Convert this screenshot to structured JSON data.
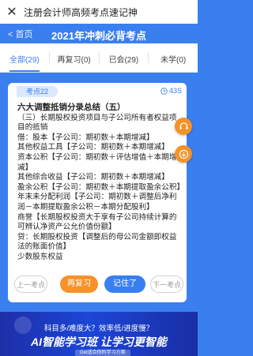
{
  "app": {
    "title": "注册会计师高频考点速记神",
    "close_glyph": "✕"
  },
  "header": {
    "back_label": "< 首页",
    "title": "2021年冲刺必背考点"
  },
  "tabs": [
    {
      "label": "全部(29)",
      "active": true
    },
    {
      "label": "再复习(0)",
      "active": false
    },
    {
      "label": "已会(29)",
      "active": false
    },
    {
      "label": "未学(0)",
      "active": false
    }
  ],
  "card": {
    "tag": "考点22",
    "timer": "43S",
    "heading": "六大调整抵销分录总结（五）",
    "lines": [
      "（三）长期股权投资项目与子公司所有者权益项目的抵销",
      "借：股本【子公司：期初数＋本期增减】",
      "其他权益工具【子公司：期初数＋本期增减】",
      "资本公积【子公司：期初数＋评估增值＋本期增减】",
      "其他综合收益【子公司：期初数＋本期增减】",
      "盈余公积【子公司：期初数＋本期提取盈余公积】",
      "年末未分配利润【子公司：期初数＋调整后净利润－本期提取盈余公积－本期分配股利】",
      "商誉【长期股权投资大于享有子公司持续计算的可辨认净资产公允价值份额】",
      "贷：长期股权投资【调整后的母公司金额即权益法的账面价值】",
      "少数股东权益"
    ],
    "buttons": {
      "prev": "上一考点",
      "review": "再复习",
      "remember": "记住了",
      "next": "下一考点"
    }
  },
  "banner": {
    "line1": "科目多/难度大？效率低/进度慢？",
    "line2": "AI智能学习班 让学习更智能",
    "badge": "Get适合你的学习方案"
  },
  "colors": {
    "primary": "#3a7ff0",
    "accent": "#f5922a"
  },
  "icons": [
    "close-icon",
    "clock-icon",
    "headset-icon",
    "arrow-down-circle-icon"
  ]
}
